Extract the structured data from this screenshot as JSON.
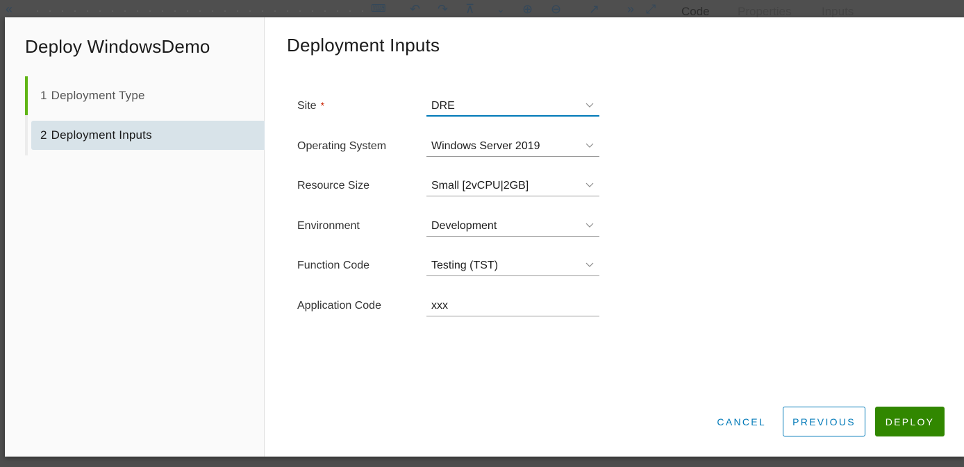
{
  "background": {
    "toolbar_icons": [
      "collapse-left-icon",
      "keyboard-icon",
      "undo-icon",
      "redo-icon",
      "fit-icon",
      "expand-down-icon",
      "zoom-in-icon",
      "zoom-out-icon",
      "open-external-icon",
      "collapse-right-icon",
      "maximize-icon"
    ],
    "tabs": [
      {
        "label": "Code",
        "active": true
      },
      {
        "label": "Properties",
        "active": false
      },
      {
        "label": "Inputs",
        "active": false
      }
    ]
  },
  "modal": {
    "title": "Deploy WindowsDemo",
    "steps": [
      {
        "number": "1",
        "label": "Deployment Type",
        "state": "done"
      },
      {
        "number": "2",
        "label": "Deployment Inputs",
        "state": "current"
      }
    ],
    "section_title": "Deployment Inputs",
    "fields": [
      {
        "label": "Site",
        "required": true,
        "required_mark": "*",
        "type": "select",
        "value": "DRE"
      },
      {
        "label": "Operating System",
        "required": false,
        "type": "select",
        "value": "Windows Server 2019"
      },
      {
        "label": "Resource Size",
        "required": false,
        "type": "select",
        "value": "Small [2vCPU|2GB]"
      },
      {
        "label": "Environment",
        "required": false,
        "type": "select",
        "value": "Development"
      },
      {
        "label": "Function Code",
        "required": false,
        "type": "select",
        "value": "Testing (TST)"
      },
      {
        "label": "Application Code",
        "required": false,
        "type": "text",
        "value": "xxx"
      }
    ],
    "buttons": {
      "cancel": "CANCEL",
      "previous": "PREVIOUS",
      "deploy": "DEPLOY"
    }
  },
  "colors": {
    "accent": "#0079b8",
    "deploy": "#318700",
    "step_done": "#60b515",
    "required": "#c92100",
    "step_current_bg": "#d8e3e9"
  }
}
